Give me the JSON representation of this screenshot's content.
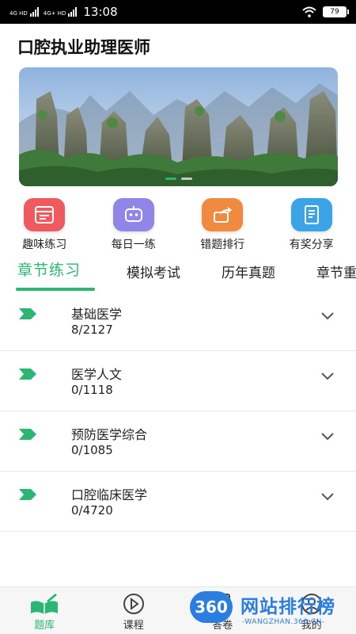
{
  "status_bar": {
    "network_1": "4G HD",
    "network_2": "4G+ HD",
    "time": "13:08",
    "battery": "79"
  },
  "page_title": "口腔执业助理医师",
  "banner": {
    "slides": 2,
    "active_slide": 1
  },
  "actions": [
    {
      "label": "趣味练习",
      "icon": "fun-practice-icon",
      "color": "#ef5a5f"
    },
    {
      "label": "每日一练",
      "icon": "robot-icon",
      "color": "#8f86e8"
    },
    {
      "label": "错题排行",
      "icon": "share-arrow-icon",
      "color": "#f08a3e"
    },
    {
      "label": "有奖分享",
      "icon": "notebook-icon",
      "color": "#3ba3e8"
    }
  ],
  "tabs": [
    "章节练习",
    "模拟考试",
    "历年真题",
    "章节重"
  ],
  "active_tab": 0,
  "chapters": [
    {
      "name": "基础医学",
      "progress": "8/2127"
    },
    {
      "name": "医学人文",
      "progress": "0/1118"
    },
    {
      "name": "预防医学综合",
      "progress": "0/1085"
    },
    {
      "name": "口腔临床医学",
      "progress": "0/4720"
    }
  ],
  "bottom_nav": [
    {
      "label": "题库",
      "icon": "question-bank-icon"
    },
    {
      "label": "课程",
      "icon": "play-circle-icon"
    },
    {
      "label": "答卷",
      "icon": "paper-icon"
    },
    {
      "label": "我的",
      "icon": "profile-icon"
    }
  ],
  "watermark": {
    "badge": "360",
    "title": "网站排行榜",
    "url": "-WANGZHAN.360.CN-"
  },
  "colors": {
    "accent": "#2bb673",
    "status_bar": "#000000"
  }
}
